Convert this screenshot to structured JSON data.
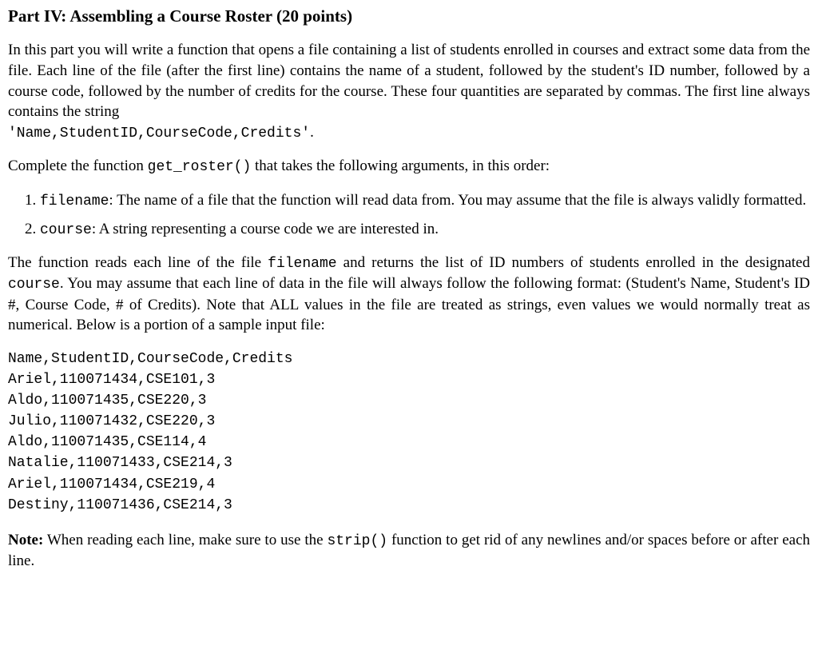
{
  "heading": "Part IV: Assembling a Course Roster (20 points)",
  "p1_a": "In this part you will write a function that opens a file containing a list of students enrolled in courses and extract some data from the file. Each line of the file (after the first line) contains the name of a student, followed by the student's ID number, followed by a course code, followed by the number of credits for the course. These four quantities are separated by commas. The first line always contains the string",
  "p1_code": "'Name,StudentID,CourseCode,Credits'",
  "p1_b": ".",
  "p2_a": "Complete the function ",
  "p2_code": "get_roster()",
  "p2_b": " that takes the following arguments, in this order:",
  "arg1_code": "filename",
  "arg1_text": ": The name of a file that the function will read data from. You may assume that the file is always validly formatted.",
  "arg2_code": "course",
  "arg2_text": ": A string representing a course code we are interested in.",
  "p3_a": "The function reads each line of the file ",
  "p3_code1": "filename",
  "p3_b": " and returns the list of ID numbers of students enrolled in the designated ",
  "p3_code2": "course",
  "p3_c": ". You may assume that each line of data in the file will always follow the following format: (Student's Name, Student's ID #, Course Code, # of Credits). Note that ALL values in the file are treated as strings, even values we would normally treat as numerical. Below is a portion of a sample input file:",
  "sample": "Name,StudentID,CourseCode,Credits\nAriel,110071434,CSE101,3\nAldo,110071435,CSE220,3\nJulio,110071432,CSE220,3\nAldo,110071435,CSE114,4\nNatalie,110071433,CSE214,3\nAriel,110071434,CSE219,4\nDestiny,110071436,CSE214,3",
  "note_label": "Note:",
  "note_a": " When reading each line, make sure to use the ",
  "note_code": "strip()",
  "note_b": " function to get rid of any newlines and/or spaces before or after each line."
}
